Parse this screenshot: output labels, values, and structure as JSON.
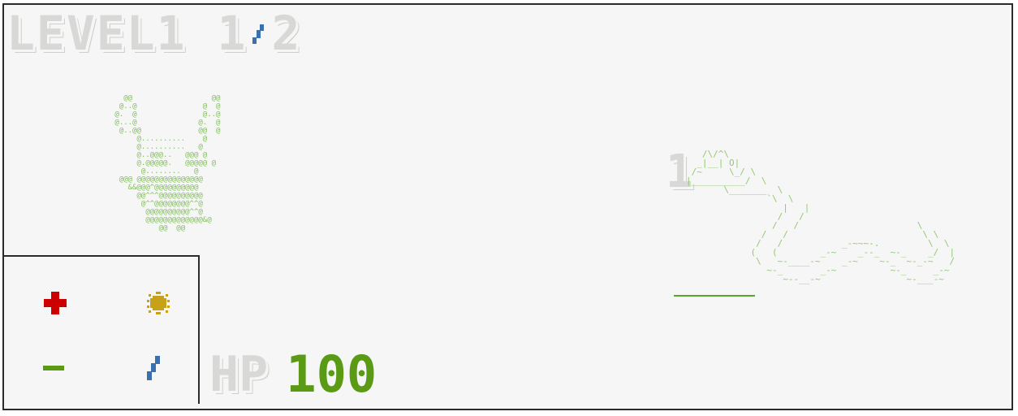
{
  "hud": {
    "level_label": "LEVEL1",
    "encounter_current": "1",
    "encounter_total": "2",
    "hp_label": "HP",
    "hp_value": "100"
  },
  "enemy": {
    "count": "1",
    "hp_fraction": 1.0,
    "sprite_name": "snake",
    "ascii": "   /\\/^\\\n  _|__| O|\n /~     \\_/ \\\n|__________/  \\\n       \\_______  \\\n               `\\  \\\n                  |   |\n                 /   /\n                /   /                      \\\n              /   /                         \\ \\\n             /   /           _-~~~-.         \\  \\\n            (   (        _-~    _--_  ~-_    _/  |\n             \\   ~-____-~    _-~    ~-_  ~-_-~   /\n               ~-_       _-~          ~-_     _-~\n                  ~--__-~                ~-___-~"
  },
  "player": {
    "sprite_name": "crab",
    "ascii": "   @@                  @@\n  @..@               @  @\n @.  @               @..@\n @...@              @.  @\n  @..@@             @@  @\n      @..........    @\n      @..........   @\n      @..@@@..   @@@ @\n      @.@@@@@.   @@@@@ @\n       @........   @\n  @@@ @@@@@@@@@@@@@@@\n    &&@@@^@@@@@@@@@@\n      @@^^^@@@@@@@@@@\n       @^^@@@@@@@@^^@\n        @@@@@@@@@@^^@\n        @@@@@@@@@@@@@&@\n           @@  @@"
  },
  "actions": [
    {
      "name": "heal",
      "icon": "plus-icon",
      "color": "#cc0000"
    },
    {
      "name": "magic",
      "icon": "sun-icon",
      "color": "#c8a11a"
    },
    {
      "name": "defend",
      "icon": "minus-icon",
      "color": "#5a9a14"
    },
    {
      "name": "attack",
      "icon": "sword-icon",
      "color": "#3a6fb0"
    }
  ],
  "colors": {
    "hp_green": "#5a9a14",
    "heal_red": "#cc0000",
    "magic_gold": "#c8a11a",
    "attack_blue": "#3a6fb0",
    "ascii_green": "#7fbf57"
  }
}
